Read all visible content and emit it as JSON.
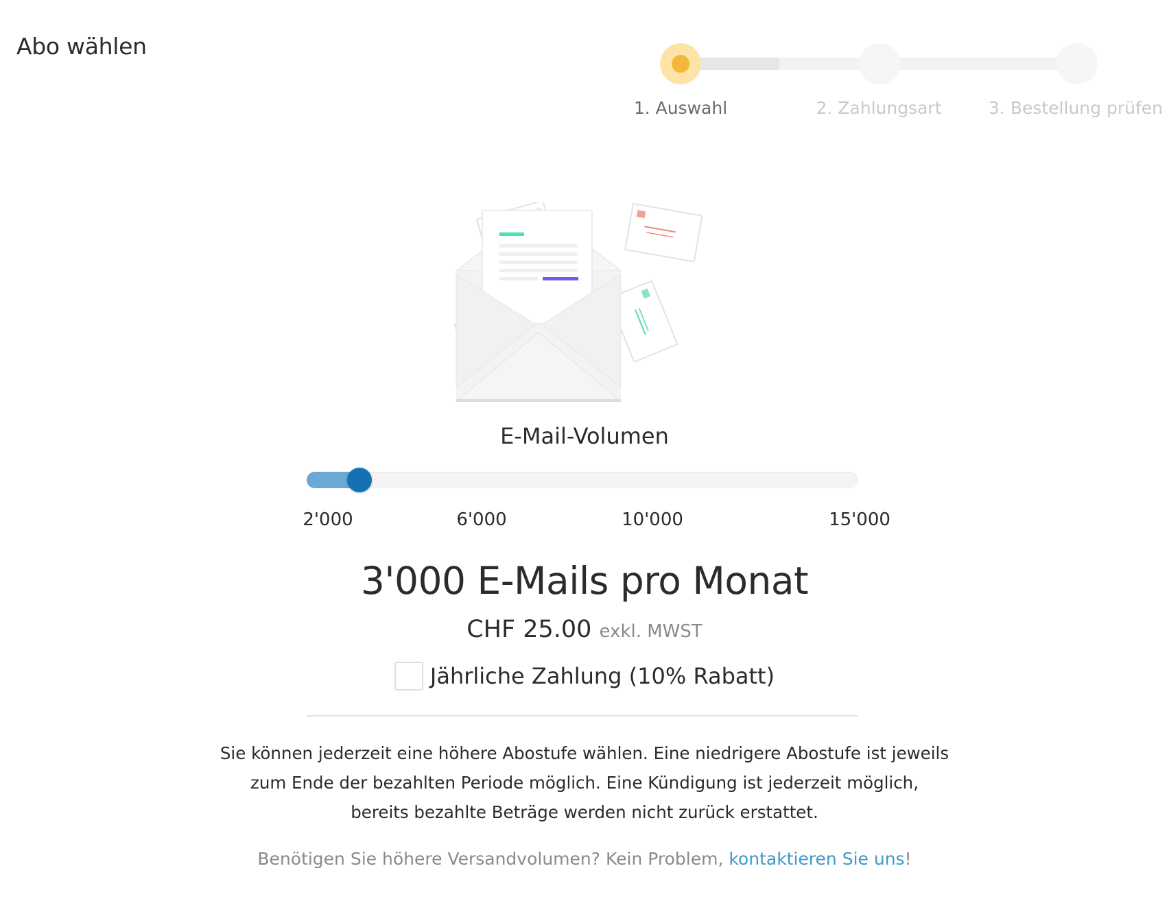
{
  "page": {
    "title": "Abo wählen"
  },
  "stepper": {
    "current_step": 1,
    "steps": [
      {
        "label": "1. Auswahl",
        "state": "active"
      },
      {
        "label": "2. Zahlungsart",
        "state": "inactive"
      },
      {
        "label": "3. Bestellung prüfen",
        "state": "inactive"
      }
    ]
  },
  "illustration": {
    "icon": "mail-envelope-illustration"
  },
  "volume": {
    "title": "E-Mail-Volumen",
    "slider": {
      "min": 2000,
      "max": 15000,
      "value": 3000,
      "ticks": [
        {
          "value": 2000,
          "label": "2'000"
        },
        {
          "value": 6000,
          "label": "6'000"
        },
        {
          "value": 10000,
          "label": "10'000"
        },
        {
          "value": 15000,
          "label": "15'000"
        }
      ]
    }
  },
  "plan": {
    "headline": "3'000 E-Mails pro Monat",
    "price": "CHF 25.00",
    "price_note": "exkl. MWST"
  },
  "annual_payment": {
    "label": "Jährliche Zahlung (10% Rabatt)",
    "checked": false
  },
  "info": {
    "text": "Sie können jederzeit eine höhere Abostufe wählen. Eine niedrigere Abostufe ist jeweils zum Ende der bezahlten Periode möglich. Eine Kündigung ist jederzeit möglich, bereits bezahlte Beträge werden nicht zurück erstattet."
  },
  "contact": {
    "prefix": "Benötigen Sie höhere Versandvolumen? Kein Problem, ",
    "link_text": "kontaktieren Sie uns",
    "suffix": "!"
  },
  "colors": {
    "step_active_outer": "#fde4a6",
    "step_active_inner": "#f4b73a",
    "slider_fill": "#6aa9d4",
    "slider_handle": "#1671b2",
    "link": "#3d9ac9"
  }
}
